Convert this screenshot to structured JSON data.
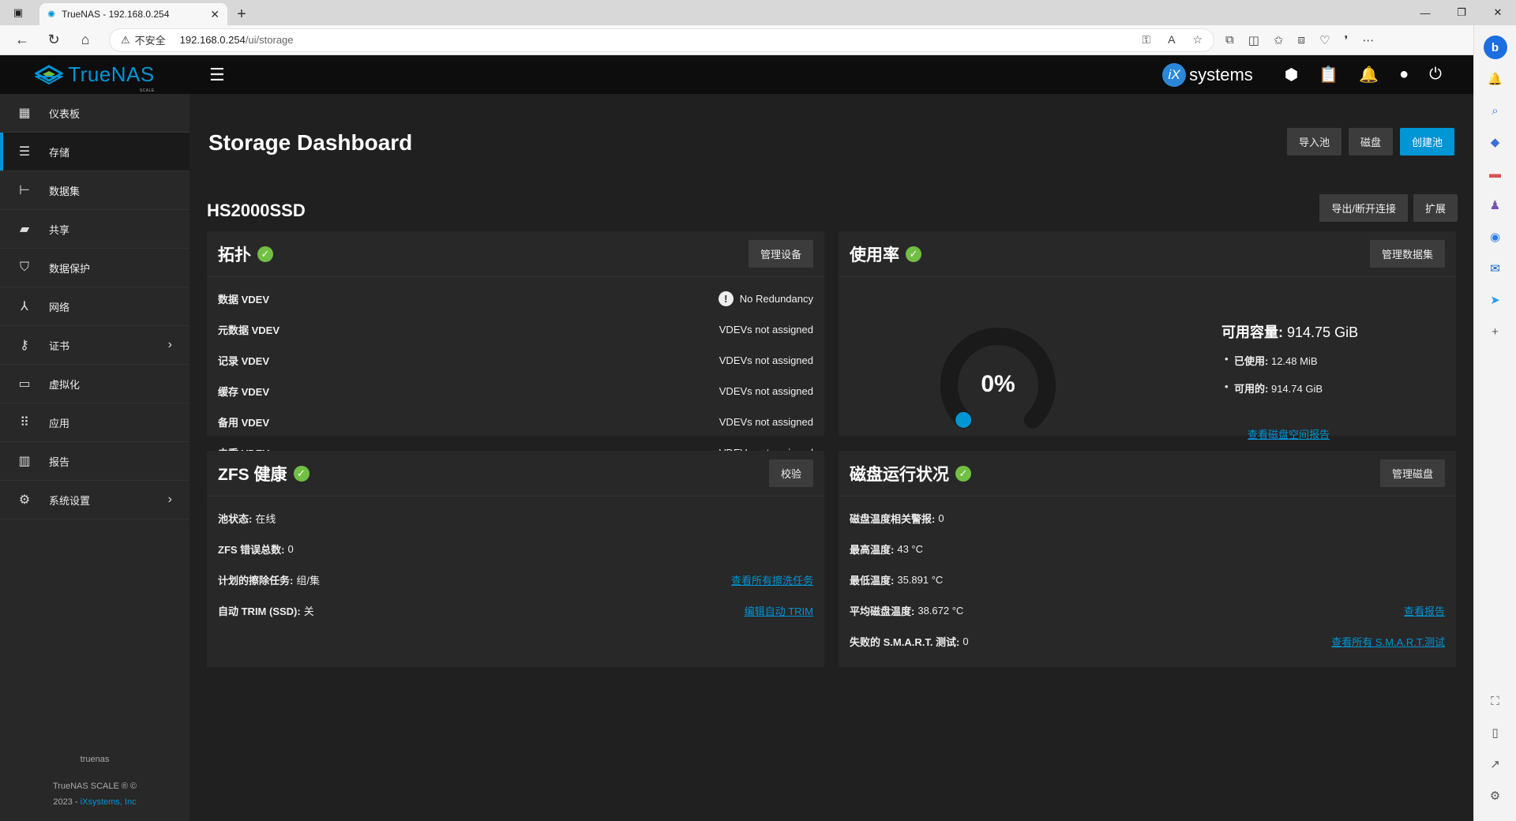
{
  "browser": {
    "tab_title": "TrueNAS - 192.168.0.254",
    "insecure_label": "不安全",
    "url_host": "192.168.0.254",
    "url_path": "/ui/storage"
  },
  "app": {
    "brand": "TrueNAS",
    "brand_sub": "SCALE",
    "vendor": "systems",
    "vendor_mark": "iX"
  },
  "sidebar": {
    "items": [
      {
        "label": "仪表板",
        "icon": "dashboard-icon"
      },
      {
        "label": "存储",
        "icon": "storage-icon"
      },
      {
        "label": "数据集",
        "icon": "datasets-icon"
      },
      {
        "label": "共享",
        "icon": "shares-icon"
      },
      {
        "label": "数据保护",
        "icon": "shield-icon"
      },
      {
        "label": "网络",
        "icon": "network-icon"
      },
      {
        "label": "证书",
        "icon": "key-icon"
      },
      {
        "label": "虚拟化",
        "icon": "laptop-icon"
      },
      {
        "label": "应用",
        "icon": "apps-icon"
      },
      {
        "label": "报告",
        "icon": "chart-icon"
      },
      {
        "label": "系统设置",
        "icon": "gear-icon"
      }
    ],
    "hostname": "truenas",
    "footer_line1": "TrueNAS SCALE ® ©",
    "footer_year": "2023 -",
    "footer_company": "iXsystems, Inc"
  },
  "main": {
    "title": "Storage Dashboard",
    "import_pool": "导入池",
    "disks": "磁盘",
    "create_pool": "创建池",
    "pool_name": "HS2000SSD",
    "export_disconnect": "导出/断开连接",
    "expand": "扩展"
  },
  "topology": {
    "title": "拓扑",
    "manage_devices": "管理设备",
    "rows": [
      {
        "label": "数据 VDEV",
        "value": "No Redundancy"
      },
      {
        "label": "元数据 VDEV",
        "value": "VDEVs not assigned"
      },
      {
        "label": "记录 VDEV",
        "value": "VDEVs not assigned"
      },
      {
        "label": "缓存 VDEV",
        "value": "VDEVs not assigned"
      },
      {
        "label": "备用 VDEV",
        "value": "VDEVs not assigned"
      },
      {
        "label": "去重 VDEV",
        "value": "VDEVs not assigned"
      }
    ]
  },
  "usage": {
    "title": "使用率",
    "manage_datasets": "管理数据集",
    "percent": "0%",
    "usable_label": "可用容量:",
    "usable_value": "914.75 GiB",
    "used_label": "已使用:",
    "used_value": "12.48 MiB",
    "available_label": "可用的:",
    "available_value": "914.74 GiB",
    "report_link": "查看磁盘空间报告",
    "colors": {
      "ring": "#1a1a1a",
      "accent": "#0095d5"
    }
  },
  "zfs": {
    "title": "ZFS 健康",
    "scrub_button": "校验",
    "pool_status_label": "池状态:",
    "pool_status_value": "在线",
    "errors_label": "ZFS 错误总数:",
    "errors_value": "0",
    "scrub_tasks_label": "计划的擦除任务:",
    "scrub_tasks_value": "组/集",
    "scrub_tasks_link": "查看所有擦洗任务",
    "trim_label": "自动 TRIM (SSD):",
    "trim_value": "关",
    "trim_link": "编辑自动 TRIM"
  },
  "disk_health": {
    "title": "磁盘运行状况",
    "manage_disks": "管理磁盘",
    "temp_alerts_label": "磁盘温度相关警报:",
    "temp_alerts_value": "0",
    "max_temp_label": "最高温度:",
    "max_temp_value": "43 °C",
    "min_temp_label": "最低温度:",
    "min_temp_value": "35.891 °C",
    "avg_temp_label": "平均磁盘温度:",
    "avg_temp_value": "38.672 °C",
    "reports_link": "查看报告",
    "smart_label": "失败的 S.M.A.R.T. 测试:",
    "smart_value": "0",
    "smart_link": "查看所有 S.M.A.R.T.测试"
  }
}
